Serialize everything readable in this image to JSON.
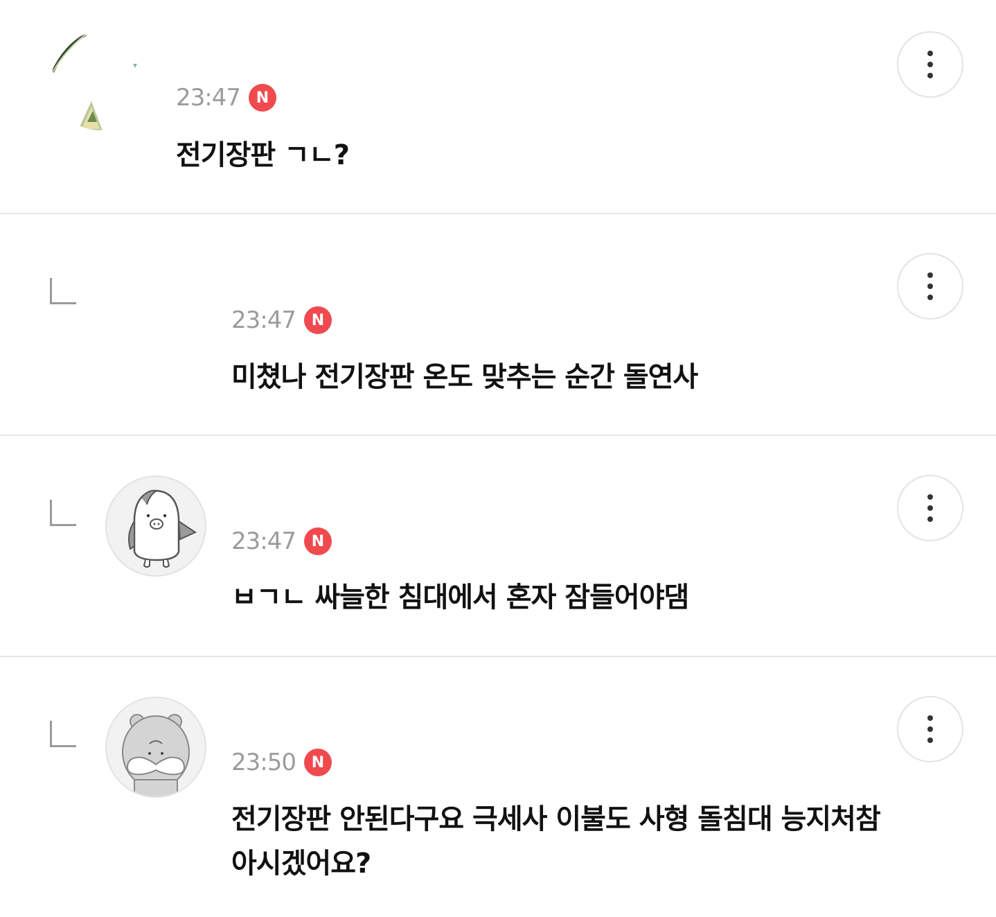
{
  "comments": [
    {
      "author": "",
      "time": "23:47",
      "badge": "N",
      "text": "전기장판 ㄱㄴ?",
      "avatar": "photo-avatar",
      "is_reply": false
    },
    {
      "author": "",
      "time": "23:47",
      "badge": "N",
      "text": "미쳤나 전기장판 온도 맞추는 순간 돌연사",
      "avatar": "none",
      "is_reply": true
    },
    {
      "author": "",
      "time": "23:47",
      "badge": "N",
      "text": "ㅂㄱㄴ 싸늘한 침대에서 혼자 잠들어야댐",
      "avatar": "penguin-avatar",
      "is_reply": true
    },
    {
      "author": "",
      "time": "23:50",
      "badge": "N",
      "text_line1": "전기장판 안된다구요 극세사 이불도 사형 돌침대 능지처참",
      "text_line2": "아시겠어요?",
      "avatar": "hamster-avatar",
      "is_reply": true
    }
  ],
  "icons": {
    "more": "more-vertical-icon",
    "reply": "reply-arrow-icon"
  },
  "colors": {
    "badge": "#f04a4f",
    "time": "#9b9b9b",
    "divider": "#e6e6e6"
  }
}
